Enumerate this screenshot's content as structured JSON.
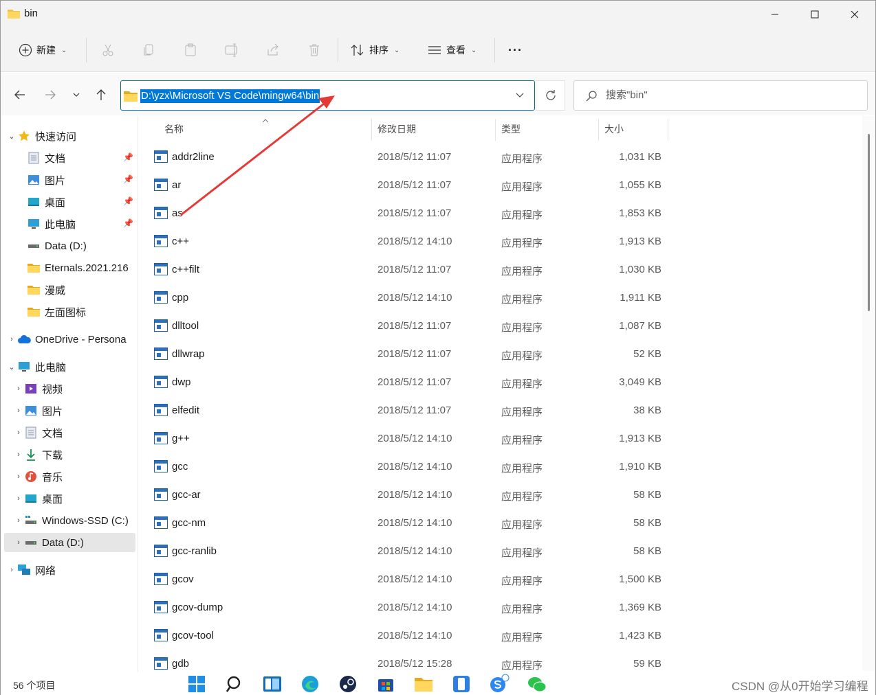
{
  "window": {
    "title": "bin",
    "controls": {
      "minimize": "minimize",
      "maximize": "maximize",
      "close": "close"
    }
  },
  "toolbar": {
    "new_label": "新建",
    "sort_label": "排序",
    "view_label": "查看",
    "more_label": "···"
  },
  "address": {
    "path": "D:\\yzx\\Microsoft VS Code\\mingw64\\bin",
    "search_placeholder": "搜索\"bin\""
  },
  "sidebar": {
    "quick_access": "快速访问",
    "quick_items": [
      {
        "label": "文档",
        "icon": "document-icon",
        "pinned": true
      },
      {
        "label": "图片",
        "icon": "pictures-icon",
        "pinned": true
      },
      {
        "label": "桌面",
        "icon": "desktop-icon",
        "pinned": true
      },
      {
        "label": "此电脑",
        "icon": "computer-icon",
        "pinned": true
      },
      {
        "label": "Data (D:)",
        "icon": "drive-icon",
        "pinned": false
      },
      {
        "label": "Eternals.2021.216",
        "icon": "folder-icon",
        "pinned": false
      },
      {
        "label": "漫威",
        "icon": "folder-icon",
        "pinned": false
      },
      {
        "label": "左面图标",
        "icon": "folder-icon",
        "pinned": false
      }
    ],
    "onedrive": "OneDrive - Persona",
    "this_pc": "此电脑",
    "pc_items": [
      {
        "label": "视频",
        "icon": "video-icon"
      },
      {
        "label": "图片",
        "icon": "pictures-icon"
      },
      {
        "label": "文档",
        "icon": "document-icon"
      },
      {
        "label": "下载",
        "icon": "download-icon"
      },
      {
        "label": "音乐",
        "icon": "music-icon"
      },
      {
        "label": "桌面",
        "icon": "desktop-icon"
      },
      {
        "label": "Windows-SSD (C:)",
        "icon": "drive-icon"
      },
      {
        "label": "Data (D:)",
        "icon": "drive-icon"
      }
    ],
    "network": "网络"
  },
  "columns": {
    "name": "名称",
    "date": "修改日期",
    "type": "类型",
    "size": "大小"
  },
  "files": [
    {
      "name": "addr2line",
      "date": "2018/5/12 11:07",
      "type": "应用程序",
      "size": "1,031 KB"
    },
    {
      "name": "ar",
      "date": "2018/5/12 11:07",
      "type": "应用程序",
      "size": "1,055 KB"
    },
    {
      "name": "as",
      "date": "2018/5/12 11:07",
      "type": "应用程序",
      "size": "1,853 KB"
    },
    {
      "name": "c++",
      "date": "2018/5/12 14:10",
      "type": "应用程序",
      "size": "1,913 KB"
    },
    {
      "name": "c++filt",
      "date": "2018/5/12 11:07",
      "type": "应用程序",
      "size": "1,030 KB"
    },
    {
      "name": "cpp",
      "date": "2018/5/12 14:10",
      "type": "应用程序",
      "size": "1,911 KB"
    },
    {
      "name": "dlltool",
      "date": "2018/5/12 11:07",
      "type": "应用程序",
      "size": "1,087 KB"
    },
    {
      "name": "dllwrap",
      "date": "2018/5/12 11:07",
      "type": "应用程序",
      "size": "52 KB"
    },
    {
      "name": "dwp",
      "date": "2018/5/12 11:07",
      "type": "应用程序",
      "size": "3,049 KB"
    },
    {
      "name": "elfedit",
      "date": "2018/5/12 11:07",
      "type": "应用程序",
      "size": "38 KB"
    },
    {
      "name": "g++",
      "date": "2018/5/12 14:10",
      "type": "应用程序",
      "size": "1,913 KB"
    },
    {
      "name": "gcc",
      "date": "2018/5/12 14:10",
      "type": "应用程序",
      "size": "1,910 KB"
    },
    {
      "name": "gcc-ar",
      "date": "2018/5/12 14:10",
      "type": "应用程序",
      "size": "58 KB"
    },
    {
      "name": "gcc-nm",
      "date": "2018/5/12 14:10",
      "type": "应用程序",
      "size": "58 KB"
    },
    {
      "name": "gcc-ranlib",
      "date": "2018/5/12 14:10",
      "type": "应用程序",
      "size": "58 KB"
    },
    {
      "name": "gcov",
      "date": "2018/5/12 14:10",
      "type": "应用程序",
      "size": "1,500 KB"
    },
    {
      "name": "gcov-dump",
      "date": "2018/5/12 14:10",
      "type": "应用程序",
      "size": "1,369 KB"
    },
    {
      "name": "gcov-tool",
      "date": "2018/5/12 14:10",
      "type": "应用程序",
      "size": "1,423 KB"
    },
    {
      "name": "gdb",
      "date": "2018/5/12 15:28",
      "type": "应用程序",
      "size": "59 KB"
    }
  ],
  "status": {
    "item_count": "56 个项目"
  },
  "watermark": "CSDN @从0开始学习编程",
  "colors": {
    "accent": "#0067c0",
    "selection": "#0078d7",
    "annotation_arrow": "#e53935",
    "folder": "#f4c243"
  }
}
